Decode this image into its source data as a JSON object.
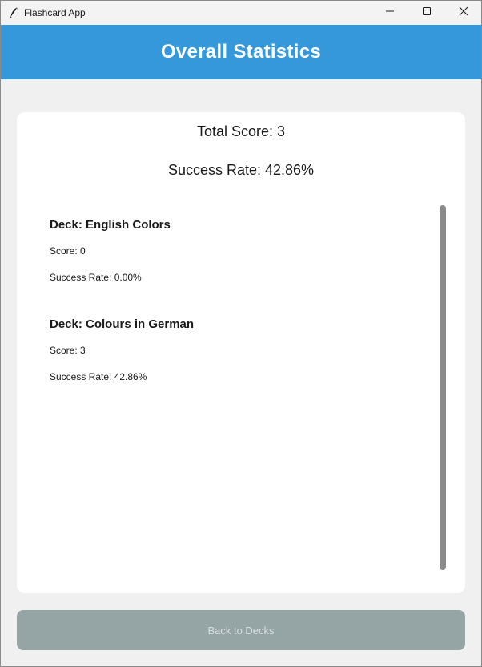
{
  "window": {
    "title": "Flashcard App"
  },
  "header": {
    "title": "Overall Statistics",
    "color": "#3498db"
  },
  "summary": {
    "total_score": "Total Score: 3",
    "success_rate": "Success Rate: 42.86%"
  },
  "decks": [
    {
      "name": "Deck: English Colors",
      "score": "Score: 0",
      "success_rate": "Success Rate: 0.00%"
    },
    {
      "name": "Deck: Colours in German",
      "score": "Score: 3",
      "success_rate": "Success Rate: 42.86%"
    }
  ],
  "footer": {
    "back_label": "Back to Decks",
    "button_color": "#95a5a6"
  },
  "icons": {
    "app": "feather-icon",
    "minimize": "minimize-icon",
    "maximize": "maximize-icon",
    "close": "close-icon"
  }
}
